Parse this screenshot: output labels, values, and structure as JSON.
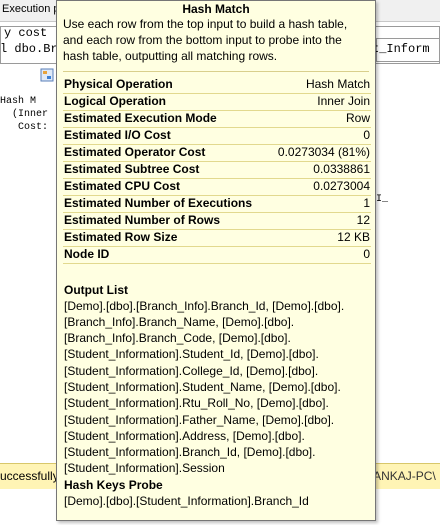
{
  "background": {
    "tab_label": "Execution pl",
    "code_line_1": "y cost",
    "code_line_2": "l dbo.Br",
    "code_right": "t_Inform",
    "node_text_1": "Hash M",
    "node_text_2": "(Inner",
    "node_text_3": "Cost:",
    "marker_right": "I_",
    "status_left": "uccessfully",
    "status_right": "PANKAJ-PC\\"
  },
  "tooltip": {
    "title": "Hash Match",
    "description": "Use each row from the top input to build a hash table, and each row from the bottom input to probe into the hash table, outputting all matching rows.",
    "properties": [
      {
        "key": "Physical Operation",
        "value": "Hash Match"
      },
      {
        "key": "Logical Operation",
        "value": "Inner Join"
      },
      {
        "key": "Estimated Execution Mode",
        "value": "Row"
      },
      {
        "key": "Estimated I/O Cost",
        "value": "0"
      },
      {
        "key": "Estimated Operator Cost",
        "value": "0.0273034 (81%)"
      },
      {
        "key": "Estimated Subtree Cost",
        "value": "0.0338861"
      },
      {
        "key": "Estimated CPU Cost",
        "value": "0.0273004"
      },
      {
        "key": "Estimated Number of Executions",
        "value": "1"
      },
      {
        "key": "Estimated Number of Rows",
        "value": "12"
      },
      {
        "key": "Estimated Row Size",
        "value": "12 KB"
      },
      {
        "key": "Node ID",
        "value": "0"
      }
    ],
    "output_list_title": "Output List",
    "output_list_lines": [
      "[Demo].[dbo].[Branch_Info].Branch_Id, [Demo].[dbo].",
      "[Branch_Info].Branch_Name, [Demo].[dbo].",
      "[Branch_Info].Branch_Code, [Demo].[dbo].",
      "[Student_Information].Student_Id, [Demo].[dbo].",
      "[Student_Information].College_Id, [Demo].[dbo].",
      "[Student_Information].Student_Name, [Demo].[dbo].",
      "[Student_Information].Rtu_Roll_No, [Demo].[dbo].",
      "[Student_Information].Father_Name, [Demo].[dbo].",
      "[Student_Information].Address, [Demo].[dbo].",
      "[Student_Information].Branch_Id, [Demo].[dbo].",
      "[Student_Information].Session"
    ],
    "hash_keys_title": "Hash Keys Probe",
    "hash_keys_value": "[Demo].[dbo].[Student_Information].Branch_Id"
  },
  "colors": {
    "tooltip_bg": "#ffffe1",
    "status_bar_bg": "#fff4b5"
  },
  "icons": [
    "hash-match-node-icon"
  ]
}
